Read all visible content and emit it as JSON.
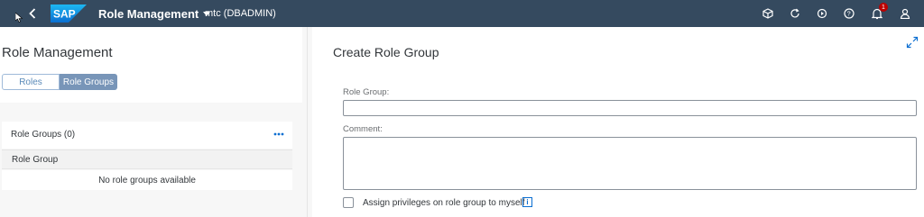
{
  "shell": {
    "logo_text": "SAP",
    "app_title": "Role Management",
    "system": "mtc (DBADMIN)",
    "notification_count": "1",
    "icons": [
      "back-icon",
      "cube-icon",
      "refresh-icon",
      "play-icon",
      "help-icon",
      "bell-icon",
      "user-icon"
    ]
  },
  "left": {
    "title": "Role Management",
    "segments": [
      "Roles",
      "Role Groups"
    ],
    "selected_segment": "Role Groups",
    "list_title": "Role Groups (0)",
    "column_header": "Role Group",
    "no_data": "No role groups available"
  },
  "form": {
    "title": "Create Role Group",
    "role_group_label": "Role Group:",
    "role_group_value": "",
    "comment_label": "Comment:",
    "comment_value": "",
    "checkbox_label": "Assign privileges on role group to myself",
    "checkbox_checked": false
  },
  "colors": {
    "shell_bg": "#354a5f",
    "accent": "#0a6ed1",
    "segment_selected": "#7895b8",
    "badge": "#bb0000"
  }
}
